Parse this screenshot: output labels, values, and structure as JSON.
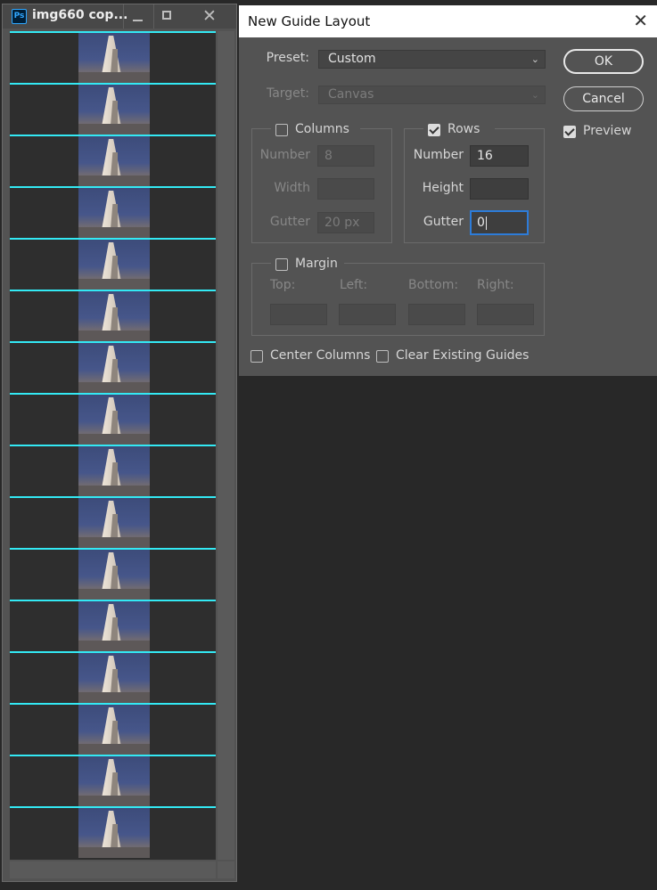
{
  "doc_window": {
    "title": "img660 cop...",
    "app_icon_text": "Ps",
    "close_glyph": "✕",
    "guide_color": "#33e9f4",
    "image_count": 16
  },
  "dialog": {
    "title": "New Guide Layout",
    "close_glyph": "✕",
    "preset": {
      "label": "Preset:",
      "value": "Custom"
    },
    "target": {
      "label": "Target:",
      "value": "Canvas"
    },
    "ok_label": "OK",
    "cancel_label": "Cancel",
    "preview": {
      "label": "Preview",
      "checked": true
    },
    "columns": {
      "label": "Columns",
      "checked": false,
      "number_label": "Number",
      "number_value": "8",
      "width_label": "Width",
      "width_value": "",
      "gutter_label": "Gutter",
      "gutter_value": "20 px"
    },
    "rows": {
      "label": "Rows",
      "checked": true,
      "number_label": "Number",
      "number_value": "16",
      "height_label": "Height",
      "height_value": "",
      "gutter_label": "Gutter",
      "gutter_value": "0"
    },
    "margin": {
      "label": "Margin",
      "checked": false,
      "top_label": "Top:",
      "left_label": "Left:",
      "bottom_label": "Bottom:",
      "right_label": "Right:"
    },
    "center_columns": {
      "label": "Center Columns",
      "checked": false
    },
    "clear_guides": {
      "label": "Clear Existing Guides",
      "checked": false
    },
    "focus_color": "#2d7cd9"
  }
}
